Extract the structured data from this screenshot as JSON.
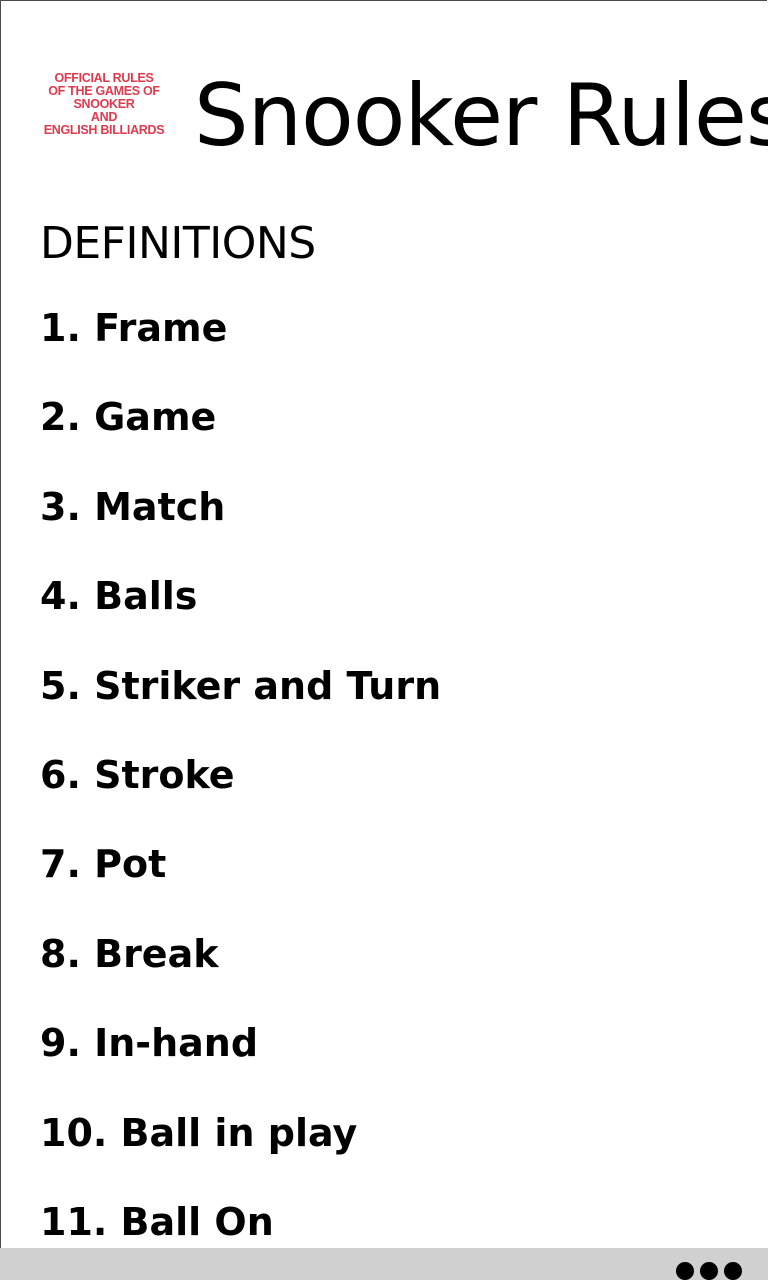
{
  "header": {
    "logo_lines": [
      "OFFICIAL RULES",
      "OF THE GAMES OF",
      "SNOOKER",
      "AND",
      "ENGLISH BILLIARDS"
    ],
    "title": "Snooker Rules"
  },
  "section": {
    "heading": "DEFINITIONS"
  },
  "rules": [
    "1. Frame",
    "2. Game",
    "3. Match",
    "4. Balls",
    "5. Striker and Turn",
    "6. Stroke",
    "7. Pot",
    "8. Break",
    "9. In-hand",
    "10. Ball in play",
    "11. Ball On"
  ],
  "appbar": {
    "more_icon": "ellipsis-icon"
  },
  "colors": {
    "logo_red": "#e03a4e",
    "appbar_bg": "#d0d0d0"
  }
}
